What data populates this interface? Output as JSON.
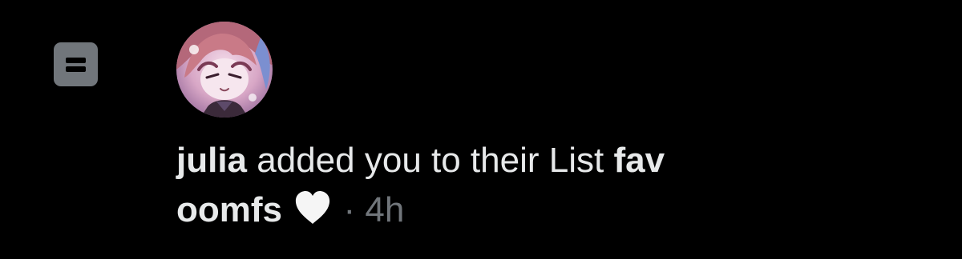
{
  "notification": {
    "type_icon": "list-icon",
    "avatar_icon": "avatar-icon",
    "user_name": "julia",
    "action_text": "added you to their List",
    "list_name_part1": "fav",
    "list_name_part2": "oomfs",
    "list_emoji": "heart-icon",
    "separator": "·",
    "time": "4h"
  },
  "colors": {
    "background": "#000000",
    "text": "#e7e9ea",
    "secondary": "#71767b",
    "heart": "#f5f5f5"
  }
}
